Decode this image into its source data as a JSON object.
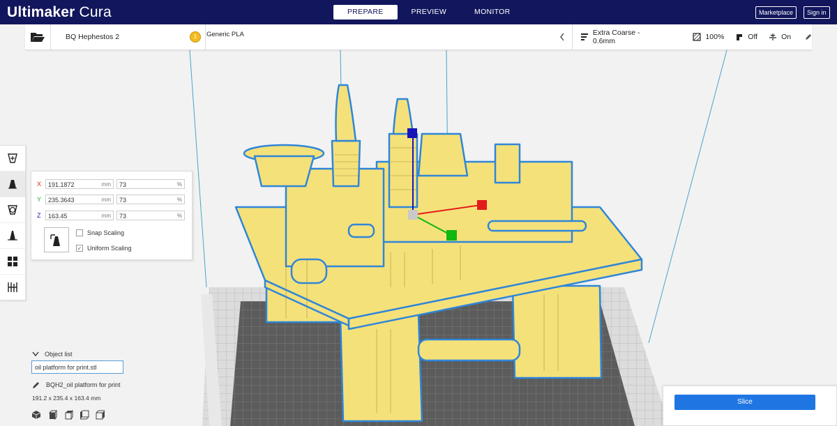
{
  "app": {
    "logo_bold": "Ultimaker",
    "logo_light": " Cura",
    "stages": [
      {
        "label": "PREPARE",
        "active": true
      },
      {
        "label": "PREVIEW",
        "active": false
      },
      {
        "label": "MONITOR",
        "active": false
      }
    ],
    "marketplace_label": "Marketplace",
    "signin_label": "Sign in"
  },
  "header": {
    "printer": "BQ Hephestos 2",
    "material_badge": "1",
    "material": "Generic PLA",
    "profile": "Extra Coarse - 0.6mm",
    "infill": "100%",
    "support": "Off",
    "adhesion": "On"
  },
  "scale_panel": {
    "x_label": "X",
    "x_mm": "191.1872",
    "x_pct": "73",
    "y_label": "Y",
    "y_mm": "235.3643",
    "y_pct": "73",
    "z_label": "Z",
    "z_mm": "163.45",
    "z_pct": "73",
    "unit_mm": "mm",
    "unit_pct": "%",
    "snap_label": "Snap Scaling",
    "snap_checked": false,
    "uniform_label": "Uniform Scaling",
    "uniform_checked": true,
    "check_glyph": "✓"
  },
  "object_list": {
    "header": "Object list",
    "item": "oil platform for print.stl",
    "name": "BQH2_oil platform for print",
    "dimensions": "191.2 x 235.4 x 163.4 mm"
  },
  "slice": {
    "label": "Slice"
  },
  "colors": {
    "topbar": "#12165c",
    "accent": "#1f76e3",
    "model": "#f5e17a",
    "model_outline": "#2f86d8",
    "axis_x": "#e21b1b",
    "axis_y": "#11b80f",
    "axis_z": "#1515b8"
  },
  "icons": [
    "folder-open-icon",
    "chevron-left-icon",
    "layer-height-icon",
    "infill-icon",
    "support-icon",
    "adhesion-icon",
    "pencil-icon",
    "move-tool-icon",
    "scale-tool-icon",
    "rotate-tool-icon",
    "mirror-tool-icon",
    "per-model-settings-icon",
    "support-blocker-icon",
    "chevron-down-icon",
    "pencil-icon",
    "view-3d-icon",
    "view-front-icon",
    "view-top-icon",
    "view-left-icon",
    "view-right-icon"
  ]
}
